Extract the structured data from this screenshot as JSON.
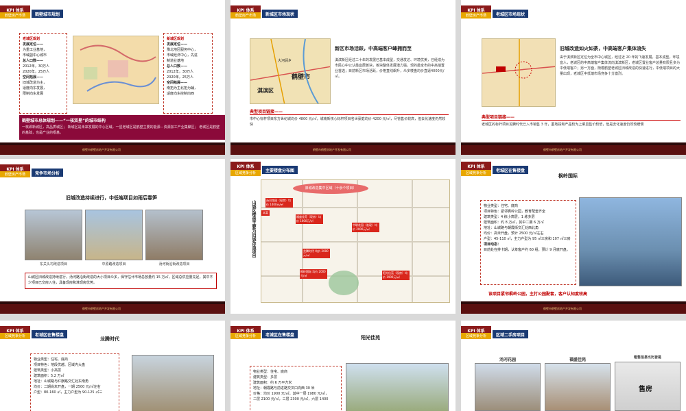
{
  "slides": [
    {
      "kpi": "KPI 体系",
      "sub": "鹤壁房产市场",
      "title": "鹤壁城市规划",
      "left_box": [
        "老城区规划",
        "发展定位——",
        "为重工业基地，",
        "市域副中心城市",
        "总人口数——",
        "2012年，30万人",
        "2020年，25万人",
        "空间拓展——",
        "旧城改造为主，",
        "适度向东发展，",
        "限制向东发展"
      ],
      "right_box": [
        "新城区规划",
        "发展定位——",
        "豫北地区服务中心，",
        "市域经济中心，先进",
        "制造业基地",
        "总人口数——",
        "2012年，30万人",
        "2020年，25万人",
        "空间拓展——",
        "南拓为主北拓为辅，",
        "适度向东控制向西"
      ],
      "banner_title": "鹤壁城市总体规划——“一核双星”的城市结构",
      "banner_text": "一核即新城区，高品质城区；   新城区是未来发展的中心区域，一星老城区是鹤壁主要的能源－资源加工产业集聚区；   老城区是鹤壁的基础，也是产业的根基。"
    },
    {
      "kpi": "KPI 体系",
      "sub": "鹤壁房产市场",
      "title": "新城区市场现状",
      "heading": "新区市场活跃，中高端客户峰拥而至",
      "para": "淇滨新区经过二十年的发展已基本成型，交通发达、环境优美，已经成为市民心中公认最宜居板块，板块整体发展潜力强，现的最全市的中高端置业首选；目前新区市场活跃，价格直线飙升，众多楼盘均价直逼4000元/㎡。",
      "map_labels": [
        "大河涧乡",
        "鹤壁市",
        "淇滨区"
      ],
      "case_title": "典型项目链接——",
      "case_text": "市中心标杆项目东方世纪城均价 4800 元/㎡，城南新核心标杆项目名世豪庭均价 4200 元/㎡，尽管售价较高，但去化速度仍然较快"
    },
    {
      "kpi": "KPI 体系",
      "sub": "鹤壁房产市场",
      "title": "老城区市场现状",
      "heading": "旧城改造如火如荼，中高端客户集体流失",
      "para": "由于淇滨新区定位为全市中心城区，经过近 20 年的飞速发展，基本成型，环境宜人，老城区的中高端客户集体流向淇滨新区，老城区置业客户总量有限且多为中低端客户；另一方面，随着鹤壁老城区旧城改造的快速进行，中低端项目的大量出现，老城区中低端市场竞争十分激烈。",
      "case_title": "典型项目链接——",
      "case_text": "老城区的标杆项目龙腾时代已入市销售 3 年，虽地段和产品较为上乘且售价较低，但是去化速度仍然较缓慢"
    },
    {
      "kpi": "KPI 体系",
      "sub": "鹤壁房产市场",
      "title": "竞争市场分析",
      "heading": "旧城改造持续进行，中低端项目如雨后春笋",
      "captions": [
        "东关头村改造项目",
        "中原路改造项目",
        "汤河街沿街改造项目"
      ],
      "red_box": "山城区旧城改造持续进行，汤河路沿街改造的大小项目众多，保守估计市场总放量约 15 万㎡，区域总供应量充足，其中不少项目已交房入住，具备现房和准现房优势。"
    },
    {
      "kpi": "KPI 体系",
      "sub": "区域竞争分析",
      "title": "主要楼盘分布图",
      "vertical_title": "山城区楼盘主要为旧城改造项目",
      "oval": "旧城改造集中区域（十余个项目）",
      "tags": [
        "汤河花园（现房）均价 1400元/㎡",
        "福盛佳苑（现房）均价 1600元/㎡",
        "中联花园（准现）均价 2000元/㎡",
        "龙腾时代 均价 2000元/㎡",
        "枫岭国际 均价 2000元/㎡",
        "阳光佳苑（现房）均价 1900元/㎡"
      ],
      "left_tag": "本案"
    },
    {
      "kpi": "KPI 体系",
      "sub": "区域竞争分析",
      "title": "老城区在售楼盘",
      "project": "枫岭国际",
      "box": [
        "物业类型：住宅、底商",
        "项目特色：紧邻枫岭公园，教育配套齐全",
        "建筑类型：4 栋小高层，1 栋多层",
        "建筑面积：约 8 万㎡，其中二期 6 万㎡",
        "地址：山城路与朝霞街交汇处西北角",
        "均价：高未开盘，预计 2500 元/㎡左右",
        "户型：45-110 ㎡，主力户型为 95 ㎡三房和 107 ㎡三房",
        "项目动态：",
        "目前处在排卡期，认筹客户约 60 组，预计 9 月底开盘。"
      ],
      "footnote": "该项目紧邻枫岭公园，主打公园配套，客户认知度较高"
    },
    {
      "kpi": "KPI 体系",
      "sub": "区域竞争分析",
      "title": "老城区在售楼盘",
      "project": "龙腾时代",
      "box": [
        "物业类型：住宅、底商",
        "项目特色：地段优越、区域内大盘",
        "建筑类型：小高层",
        "建筑面积：5.2 万㎡",
        "地址：山城路与红旗路交汇处东南角",
        "均价：二期尚未开盘，一期 2500 元/㎡左右",
        "户型：80-160 ㎡，主力户型为 90-125 ㎡三"
      ]
    },
    {
      "kpi": "KPI 体系",
      "sub": "区域竞争分析",
      "title": "老城区在售楼盘",
      "project": "阳光佳苑",
      "box": [
        "物业类型：住宅、底商",
        "建筑类型：多层",
        "建筑面积：约 6 万平方米",
        "地址：朝霞路与前进路交叉口向西 30 米",
        "价格：均价 1900 元/㎡，其中一层 1980 元/㎡，",
        "二层 2100 元/㎡，三层 2300 元/㎡，六层 1400"
      ]
    },
    {
      "kpi": "KPI 体系",
      "sub": "区域竞争分析",
      "title": "区域二手房项目",
      "captions": [
        "汤河花园",
        "福盛佳苑",
        "租售信息比比皆是"
      ],
      "sign_text": "售房"
    }
  ],
  "footer_note": "鹤壁市鹤壁房地产开发有限公司"
}
